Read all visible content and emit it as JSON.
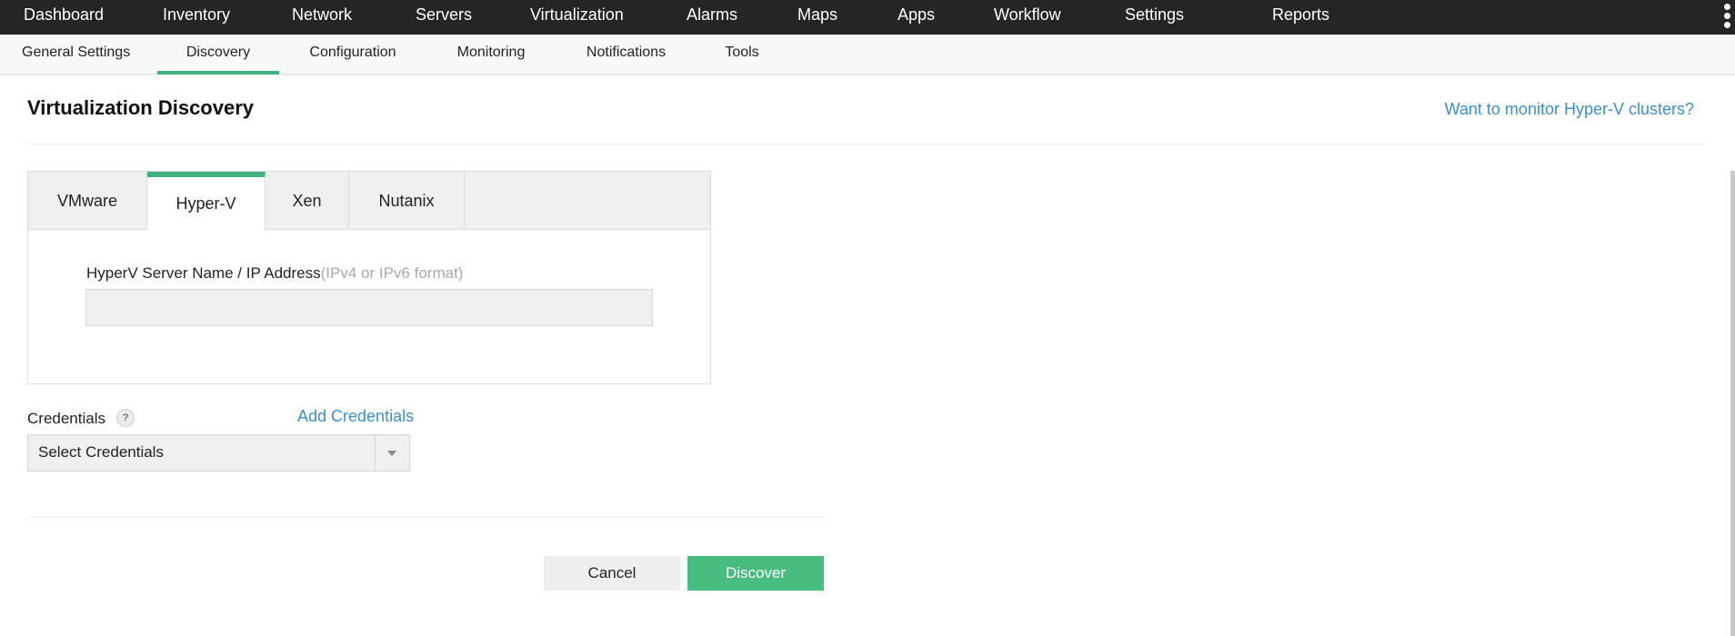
{
  "top_nav": {
    "items": [
      {
        "label": "Dashboard"
      },
      {
        "label": "Inventory"
      },
      {
        "label": "Network"
      },
      {
        "label": "Servers"
      },
      {
        "label": "Virtualization"
      },
      {
        "label": "Alarms"
      },
      {
        "label": "Maps"
      },
      {
        "label": "Apps"
      },
      {
        "label": "Workflow"
      },
      {
        "label": "Settings"
      },
      {
        "label": "Reports"
      }
    ],
    "more_icon": "kebab-vertical-icon"
  },
  "sub_nav": {
    "items": [
      {
        "label": "General Settings"
      },
      {
        "label": "Discovery",
        "active": true
      },
      {
        "label": "Configuration"
      },
      {
        "label": "Monitoring"
      },
      {
        "label": "Notifications"
      },
      {
        "label": "Tools"
      }
    ]
  },
  "page": {
    "title": "Virtualization Discovery",
    "cluster_link": "Want to monitor Hyper-V clusters?"
  },
  "tabs": {
    "items": [
      {
        "label": "VMware"
      },
      {
        "label": "Hyper-V",
        "active": true
      },
      {
        "label": "Xen"
      },
      {
        "label": "Nutanix"
      }
    ]
  },
  "server_field": {
    "label": "HyperV Server Name / IP Address",
    "hint": "(IPv4 or IPv6 format)",
    "value": ""
  },
  "credentials": {
    "label": "Credentials",
    "help_icon_glyph": "?",
    "add_link": "Add Credentials",
    "selected": "Select Credentials"
  },
  "actions": {
    "cancel_label": "Cancel",
    "discover_label": "Discover"
  },
  "colors": {
    "accent_green": "#3fb27f",
    "discover_button": "#49bc7f",
    "link_blue": "#3b8fcb",
    "top_nav_bg": "#252525"
  }
}
